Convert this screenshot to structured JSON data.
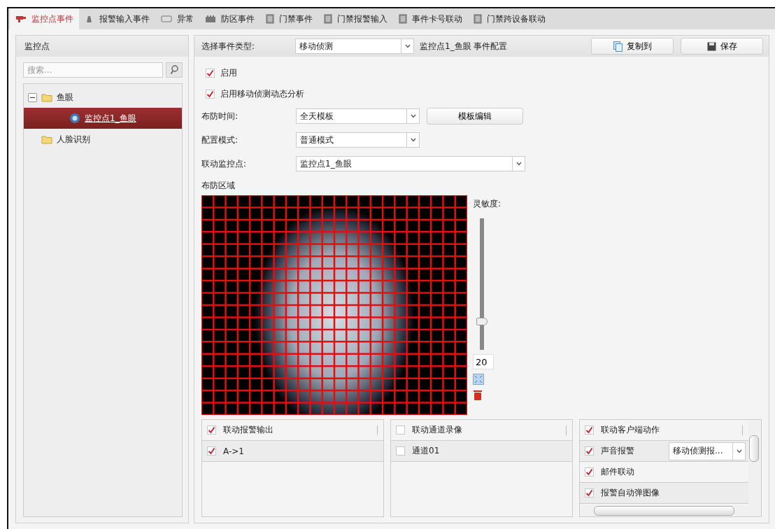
{
  "tabs": [
    {
      "label": "监控点事件",
      "selected": true
    },
    {
      "label": "报警输入事件",
      "selected": false
    },
    {
      "label": "异常",
      "selected": false
    },
    {
      "label": "防区事件",
      "selected": false
    },
    {
      "label": "门禁事件",
      "selected": false
    },
    {
      "label": "门禁报警输入",
      "selected": false
    },
    {
      "label": "事件卡号联动",
      "selected": false
    },
    {
      "label": "门禁跨设备联动",
      "selected": false
    }
  ],
  "sidebar": {
    "title": "监控点",
    "search": {
      "placeholder": "搜索..."
    },
    "tree": [
      {
        "label": "鱼眼",
        "expanded": true,
        "selected": false,
        "children": [
          {
            "label": "监控点1_鱼眼",
            "selected": true
          }
        ]
      },
      {
        "label": "人脸识别",
        "selected": false
      }
    ]
  },
  "config": {
    "event_type_label": "选择事件类型:",
    "event_type": "移动侦测",
    "title": "监控点1_鱼眼 事件配置",
    "buttons": [
      "复制到",
      "保存"
    ],
    "checkboxes": [
      {
        "label": "启用",
        "checked": true
      },
      {
        "label": "启用移动侦测动态分析",
        "checked": true
      }
    ],
    "fields": [
      {
        "label": "布防时间:",
        "value": "全天模板",
        "button": "模板编辑",
        "kind": "short"
      },
      {
        "label": "配置模式:",
        "value": "普通模式",
        "kind": "short"
      },
      {
        "label": "联动监控点:",
        "value": "监控点1_鱼眼",
        "kind": "long"
      }
    ],
    "area_label": "布防区域",
    "sensitivity": {
      "label": "灵敏度:",
      "level": 0.2,
      "value": "20"
    },
    "linkage": [
      {
        "header": {
          "label": "联动报警输出",
          "checked": true
        },
        "items": [
          {
            "label": "A->1",
            "checked": true
          }
        ]
      },
      {
        "header": {
          "label": "联动通道录像",
          "checked": false
        },
        "items": [
          {
            "label": "通道01",
            "checked": false
          }
        ]
      },
      {
        "header": {
          "label": "联动客户端动作",
          "checked": true
        },
        "items": [
          {
            "label": "声音报警",
            "checked": true,
            "select": "移动侦测报..."
          },
          {
            "label": "邮件联动",
            "checked": true
          },
          {
            "label": "报警自动弹图像",
            "checked": true
          }
        ]
      }
    ]
  }
}
